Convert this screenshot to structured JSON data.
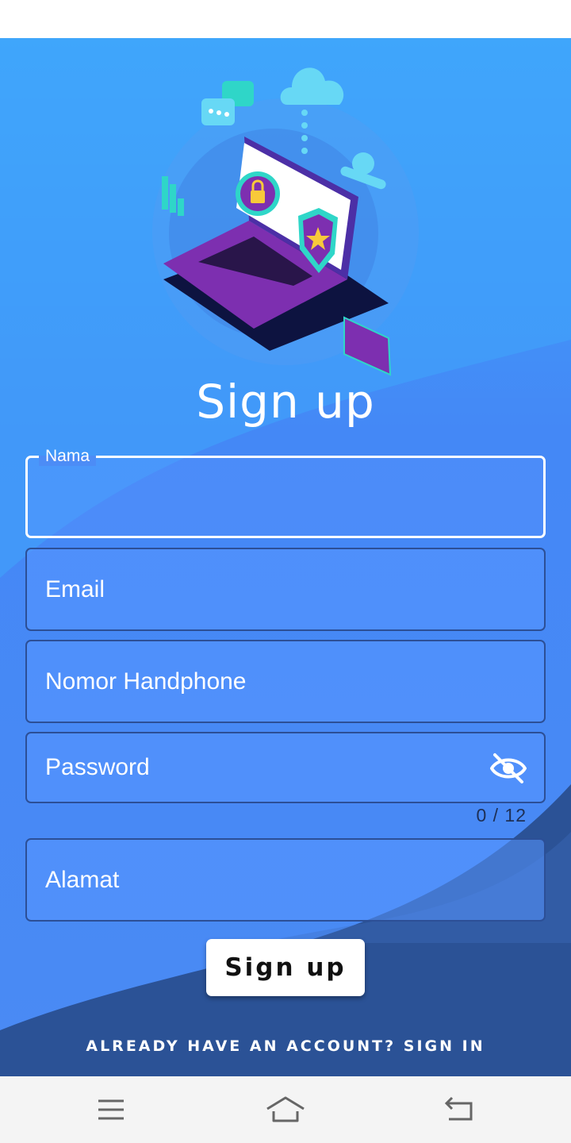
{
  "form": {
    "title": "Sign up",
    "fields": {
      "name": {
        "label": "Nama",
        "value": ""
      },
      "email": {
        "placeholder": "Email"
      },
      "phone": {
        "placeholder": "Nomor Handphone"
      },
      "password": {
        "placeholder": "Password",
        "counter": "0 / 12"
      },
      "address": {
        "placeholder": "Alamat"
      }
    },
    "submit_label": "Sign up",
    "signin_link": "ALREADY HAVE AN ACCOUNT? SIGN IN"
  },
  "icons": {
    "password_toggle": "eye-off-icon",
    "nav_menu": "menu-icon",
    "nav_home": "home-icon",
    "nav_back": "back-icon"
  },
  "colors": {
    "background_top": "#3fa6fb",
    "background_main": "#4a8af4",
    "wave_dark": "#2b5296",
    "field_border": "#2c4f96",
    "focused_border": "#ffffff",
    "button_bg": "#ffffff"
  }
}
